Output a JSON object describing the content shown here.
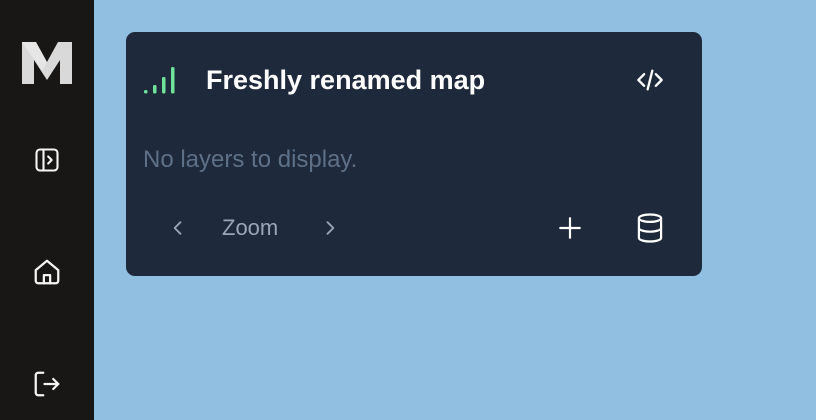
{
  "sidebar": {
    "logo_icon": "m-logo-icon",
    "items": [
      {
        "icon": "panel-toggle-icon"
      },
      {
        "icon": "home-icon"
      },
      {
        "icon": "logout-icon"
      }
    ]
  },
  "card": {
    "title": "Freshly renamed map",
    "empty_message": "No layers to display.",
    "zoom_label": "Zoom",
    "icons": {
      "signal": "signal-bars-icon",
      "code": "code-icon",
      "zoom_prev": "chevron-left-icon",
      "zoom_next": "chevron-right-icon",
      "add": "plus-icon",
      "database": "database-icon"
    }
  },
  "colors": {
    "background": "#91bfe2",
    "sidebar": "#181716",
    "card": "#1e2a3b",
    "signal_accent": "#6fe39a",
    "muted_text": "#5e7087"
  }
}
